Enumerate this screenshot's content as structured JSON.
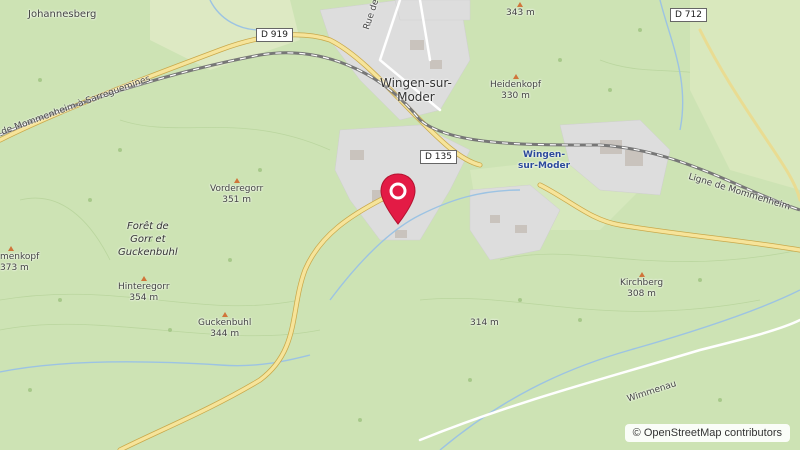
{
  "map": {
    "places": {
      "johannesberg": "Johannesberg",
      "wingen_town_line1": "Wingen-sur-",
      "wingen_town_line2": "Moder",
      "wingen_station_line1": "Wingen-",
      "wingen_station_line2": "sur-Moder",
      "forest_line1": "Forêt de",
      "forest_line2": "Gorr et",
      "forest_line3": "Guckenbuhl"
    },
    "roads": {
      "d919": "D 919",
      "d135": "D 135",
      "d712": "D 712",
      "rue_de_biche": "Rue de Biche",
      "rail_left": "de Mommenheim à Sarreguemines",
      "rail_right": "Ligne de Mommenheim",
      "wimmenau": "Wimmenau"
    },
    "peaks": [
      {
        "name": "Vorderegorr",
        "elev": "351 m"
      },
      {
        "name": "Hinteregorr",
        "elev": "354 m"
      },
      {
        "name": "Guckenbuhl",
        "elev": "344 m"
      },
      {
        "name": "Heidenkopf",
        "elev": "330 m"
      },
      {
        "name": "Kirchberg",
        "elev": "308 m"
      },
      {
        "name": "menkopf",
        "elev": "373 m"
      },
      {
        "name": "",
        "elev": "343 m"
      },
      {
        "name": "",
        "elev": "314 m"
      }
    ],
    "attribution": "© OpenStreetMap contributors",
    "marker_color": "#e31b45"
  }
}
